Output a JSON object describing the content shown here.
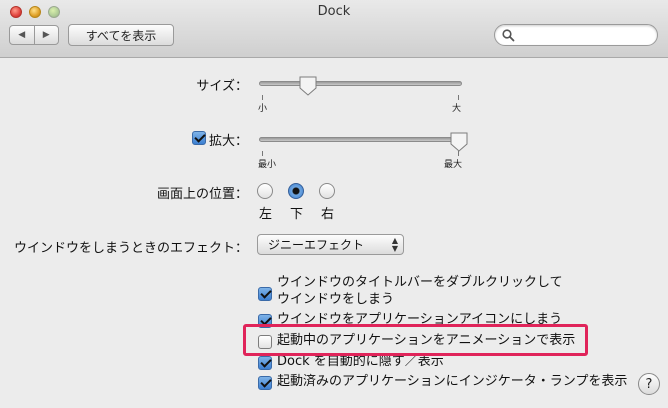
{
  "window": {
    "title": "Dock"
  },
  "toolbar": {
    "back_glyph": "◀",
    "forward_glyph": "▶",
    "show_all_label": "すべてを表示",
    "search_placeholder": ""
  },
  "size": {
    "label": "サイズ：",
    "min_label": "小",
    "max_label": "大",
    "value_fraction": 0.23
  },
  "magnification": {
    "label": "拡大：",
    "checked": true,
    "min_label": "最小",
    "max_label": "最大",
    "value_fraction": 1.0
  },
  "position": {
    "label": "画面上の位置：",
    "options": [
      "左",
      "下",
      "右"
    ],
    "selected": "下"
  },
  "effect": {
    "label": "ウインドウをしまうときのエフェクト：",
    "value": "ジニーエフェクト"
  },
  "checkboxes": [
    {
      "line1": "ウインドウのタイトルバーをダブルクリックして",
      "line2": "ウインドウをしまう",
      "checked": true
    },
    {
      "line1": "ウインドウをアプリケーションアイコンにしまう",
      "checked": true
    },
    {
      "line1": "起動中のアプリケーションをアニメーションで表示",
      "checked": false
    },
    {
      "line1": "Dock を自動的に隠す／表示",
      "checked": true
    },
    {
      "line1": "起動済みのアプリケーションにインジケータ・ランプを表示",
      "checked": true
    }
  ],
  "help": {
    "label": "?"
  },
  "colors": {
    "highlight": "#e0245a",
    "accent": "#3c7fd1"
  }
}
